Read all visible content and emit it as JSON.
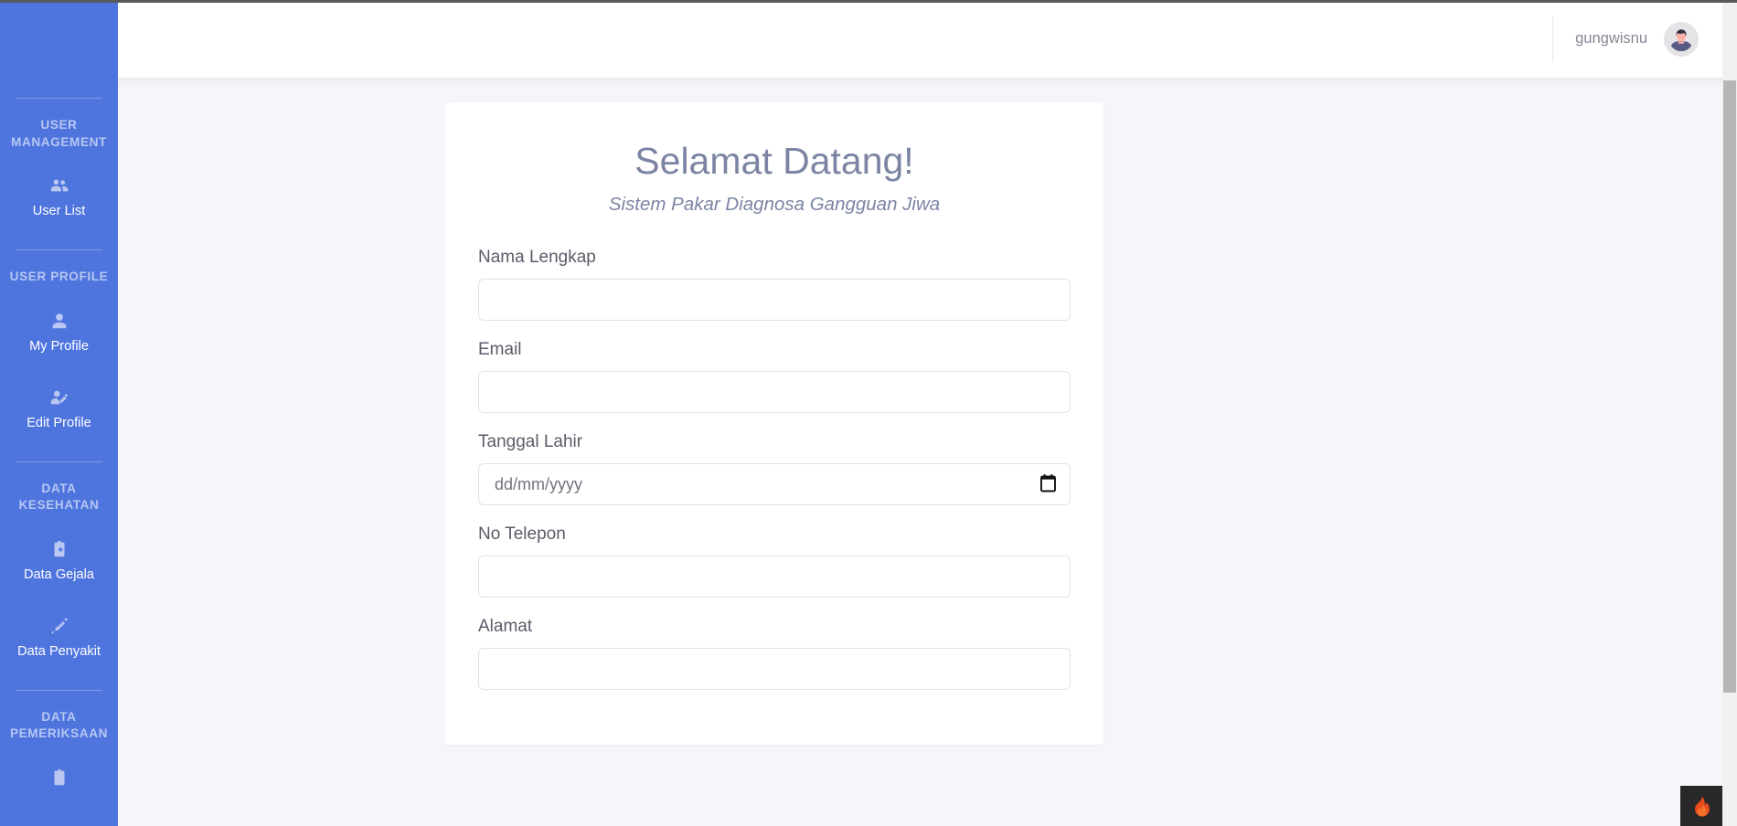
{
  "app": {
    "accent_blue": "#4e74de",
    "background": "#f5f6fa",
    "muted_text": "#858796"
  },
  "topbar": {
    "user_name": "gungwisnu",
    "avatar_icon": "user-avatar-illustration"
  },
  "sidebar": {
    "sections": [
      {
        "heading": "USER MANAGEMENT",
        "items": [
          {
            "label": "User List",
            "icon": "users-group-icon"
          }
        ]
      },
      {
        "heading": "USER PROFILE",
        "items": [
          {
            "label": "My Profile",
            "icon": "user-icon"
          },
          {
            "label": "Edit Profile",
            "icon": "user-edit-icon"
          }
        ]
      },
      {
        "heading": "DATA KESEHATAN",
        "items": [
          {
            "label": "Data Gejala",
            "icon": "clipboard-medical-icon"
          },
          {
            "label": "Data Penyakit",
            "icon": "syringe-icon"
          }
        ]
      },
      {
        "heading": "DATA PEMERIKSAAN",
        "items": []
      }
    ]
  },
  "main": {
    "title": "Selamat Datang!",
    "subtitle": "Sistem Pakar Diagnosa Gangguan Jiwa",
    "fields": [
      {
        "label": "Nama Lengkap",
        "value": "",
        "placeholder": "",
        "type": "text"
      },
      {
        "label": "Email",
        "value": "",
        "placeholder": "",
        "type": "email"
      },
      {
        "label": "Tanggal Lahir",
        "value": "",
        "placeholder": "dd/mm/yyyy",
        "type": "date"
      },
      {
        "label": "No Telepon",
        "value": "",
        "placeholder": "",
        "type": "text"
      },
      {
        "label": "Alamat",
        "value": "",
        "placeholder": "",
        "type": "text"
      }
    ]
  },
  "widgets": {
    "flame_label": "debug-flame-widget",
    "flame_color": "#e8491d"
  }
}
